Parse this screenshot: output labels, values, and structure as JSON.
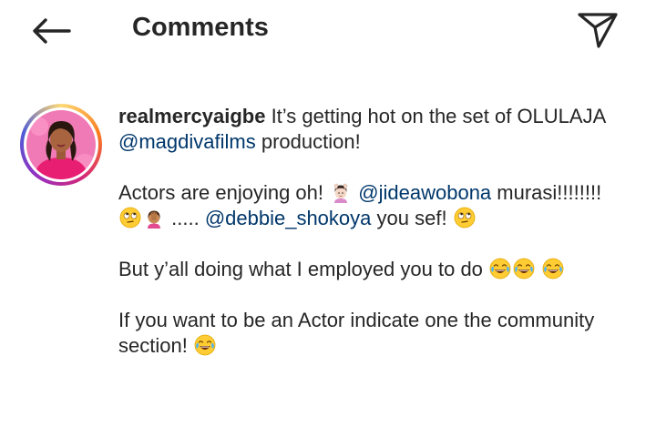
{
  "header": {
    "title": "Comments",
    "back_icon": "arrow-left-icon",
    "send_icon": "paper-plane-icon"
  },
  "comment": {
    "username": "realmercyaigbe",
    "line1": "It’s getting hot on the set of OLULAJA",
    "mention1": "@magdivafilms",
    "line1_end": "production!",
    "line2_start": "Actors are enjoying oh!",
    "mention2": "@jideawobona",
    "line2_mid": "murasi!!!!!!!!",
    "line2_dots": ".....",
    "mention3": "@debbie_shokoya",
    "line2_end": "you sef!",
    "line3": "But y’all doing what I employed you to do",
    "line4": "If you want to be an Actor indicate one the community section!"
  },
  "emojis": {
    "woman_gesturing_ok": "woman-gesturing-ok-icon",
    "rolling_eyes": "face-rolling-eyes-icon",
    "facepalm": "woman-facepalming-icon",
    "tears_of_joy": "face-tears-of-joy-icon"
  },
  "colors": {
    "mention": "#00376b",
    "text": "#262626",
    "story_ring": [
      "#feda75",
      "#fa7e1e",
      "#d62976",
      "#962fbf",
      "#4f5bd5"
    ]
  }
}
